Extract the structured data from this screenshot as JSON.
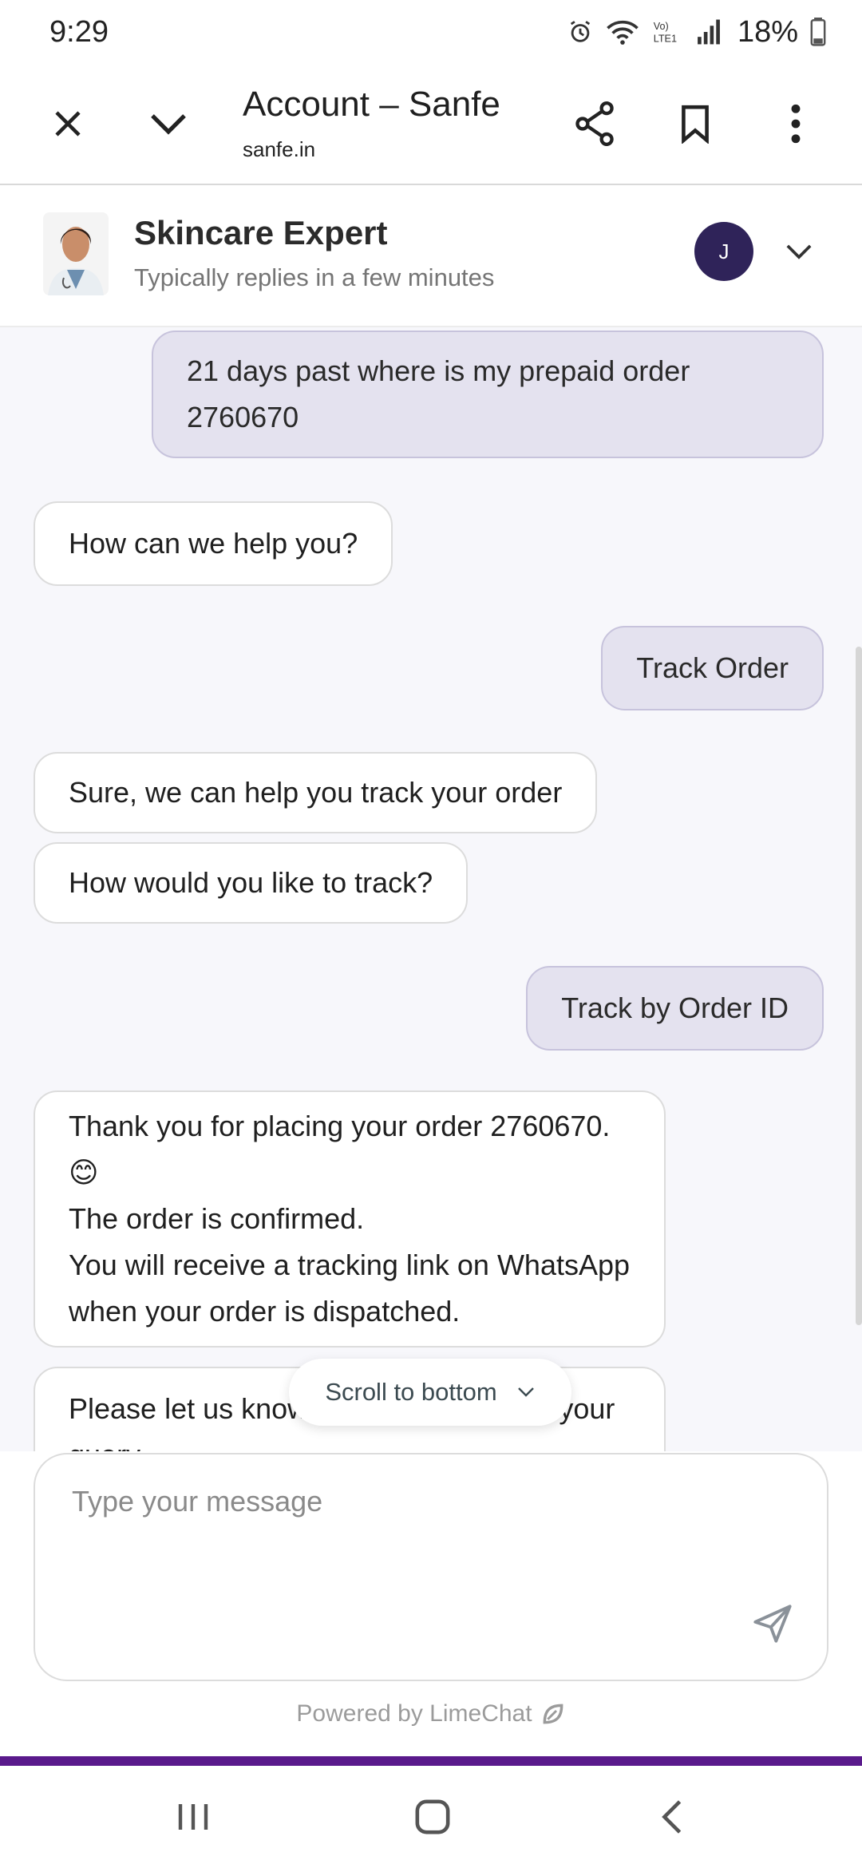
{
  "status_bar": {
    "time": "9:29",
    "battery": "18%",
    "network_label": "Vo) LTE1"
  },
  "browser": {
    "title": "Account – Sanfe",
    "url": "sanfe.in"
  },
  "chat_header": {
    "name": "Skincare Expert",
    "subtitle": "Typically replies in a few minutes",
    "user_initial": "J"
  },
  "messages": [
    {
      "from": "user",
      "text": "21 days past where is my prepaid order 2760670"
    },
    {
      "from": "bot",
      "text": "How can we help you?"
    },
    {
      "from": "user",
      "text": "Track Order"
    },
    {
      "from": "bot",
      "text": "Sure, we can help you track your order"
    },
    {
      "from": "bot",
      "text": "How would you like to track?"
    },
    {
      "from": "user",
      "text": "Track by Order ID"
    },
    {
      "from": "bot",
      "text": "Thank you for placing your order 2760670.\n😊\nThe order is confirmed.\nYou will receive a tracking link on WhatsApp when your order is dispatched."
    },
    {
      "from": "bot",
      "text": "Please let us know if we can help with your query"
    }
  ],
  "scroll_button": {
    "label": "Scroll to bottom"
  },
  "composer": {
    "placeholder": "Type your message"
  },
  "footer": {
    "powered_by": "Powered by LimeChat"
  },
  "colors": {
    "user_bubble": "#e4e2ef",
    "user_avatar": "#2f2359",
    "footer_accent": "#5a1a8c"
  }
}
